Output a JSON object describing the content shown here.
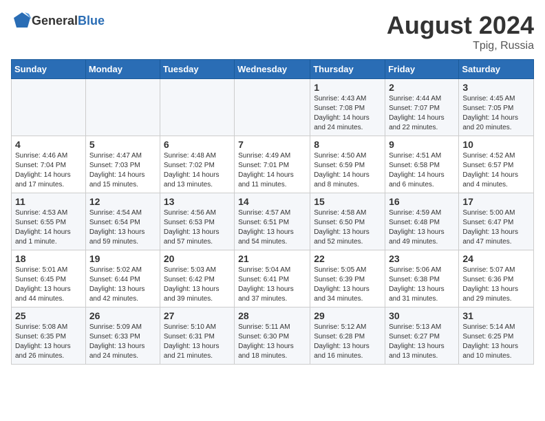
{
  "header": {
    "logo_general": "General",
    "logo_blue": "Blue",
    "title": "August 2024",
    "location": "Tpig, Russia"
  },
  "days_of_week": [
    "Sunday",
    "Monday",
    "Tuesday",
    "Wednesday",
    "Thursday",
    "Friday",
    "Saturday"
  ],
  "weeks": [
    [
      {
        "day": "",
        "info": ""
      },
      {
        "day": "",
        "info": ""
      },
      {
        "day": "",
        "info": ""
      },
      {
        "day": "",
        "info": ""
      },
      {
        "day": "1",
        "info": "Sunrise: 4:43 AM\nSunset: 7:08 PM\nDaylight: 14 hours\nand 24 minutes."
      },
      {
        "day": "2",
        "info": "Sunrise: 4:44 AM\nSunset: 7:07 PM\nDaylight: 14 hours\nand 22 minutes."
      },
      {
        "day": "3",
        "info": "Sunrise: 4:45 AM\nSunset: 7:05 PM\nDaylight: 14 hours\nand 20 minutes."
      }
    ],
    [
      {
        "day": "4",
        "info": "Sunrise: 4:46 AM\nSunset: 7:04 PM\nDaylight: 14 hours\nand 17 minutes."
      },
      {
        "day": "5",
        "info": "Sunrise: 4:47 AM\nSunset: 7:03 PM\nDaylight: 14 hours\nand 15 minutes."
      },
      {
        "day": "6",
        "info": "Sunrise: 4:48 AM\nSunset: 7:02 PM\nDaylight: 14 hours\nand 13 minutes."
      },
      {
        "day": "7",
        "info": "Sunrise: 4:49 AM\nSunset: 7:01 PM\nDaylight: 14 hours\nand 11 minutes."
      },
      {
        "day": "8",
        "info": "Sunrise: 4:50 AM\nSunset: 6:59 PM\nDaylight: 14 hours\nand 8 minutes."
      },
      {
        "day": "9",
        "info": "Sunrise: 4:51 AM\nSunset: 6:58 PM\nDaylight: 14 hours\nand 6 minutes."
      },
      {
        "day": "10",
        "info": "Sunrise: 4:52 AM\nSunset: 6:57 PM\nDaylight: 14 hours\nand 4 minutes."
      }
    ],
    [
      {
        "day": "11",
        "info": "Sunrise: 4:53 AM\nSunset: 6:55 PM\nDaylight: 14 hours\nand 1 minute."
      },
      {
        "day": "12",
        "info": "Sunrise: 4:54 AM\nSunset: 6:54 PM\nDaylight: 13 hours\nand 59 minutes."
      },
      {
        "day": "13",
        "info": "Sunrise: 4:56 AM\nSunset: 6:53 PM\nDaylight: 13 hours\nand 57 minutes."
      },
      {
        "day": "14",
        "info": "Sunrise: 4:57 AM\nSunset: 6:51 PM\nDaylight: 13 hours\nand 54 minutes."
      },
      {
        "day": "15",
        "info": "Sunrise: 4:58 AM\nSunset: 6:50 PM\nDaylight: 13 hours\nand 52 minutes."
      },
      {
        "day": "16",
        "info": "Sunrise: 4:59 AM\nSunset: 6:48 PM\nDaylight: 13 hours\nand 49 minutes."
      },
      {
        "day": "17",
        "info": "Sunrise: 5:00 AM\nSunset: 6:47 PM\nDaylight: 13 hours\nand 47 minutes."
      }
    ],
    [
      {
        "day": "18",
        "info": "Sunrise: 5:01 AM\nSunset: 6:45 PM\nDaylight: 13 hours\nand 44 minutes."
      },
      {
        "day": "19",
        "info": "Sunrise: 5:02 AM\nSunset: 6:44 PM\nDaylight: 13 hours\nand 42 minutes."
      },
      {
        "day": "20",
        "info": "Sunrise: 5:03 AM\nSunset: 6:42 PM\nDaylight: 13 hours\nand 39 minutes."
      },
      {
        "day": "21",
        "info": "Sunrise: 5:04 AM\nSunset: 6:41 PM\nDaylight: 13 hours\nand 37 minutes."
      },
      {
        "day": "22",
        "info": "Sunrise: 5:05 AM\nSunset: 6:39 PM\nDaylight: 13 hours\nand 34 minutes."
      },
      {
        "day": "23",
        "info": "Sunrise: 5:06 AM\nSunset: 6:38 PM\nDaylight: 13 hours\nand 31 minutes."
      },
      {
        "day": "24",
        "info": "Sunrise: 5:07 AM\nSunset: 6:36 PM\nDaylight: 13 hours\nand 29 minutes."
      }
    ],
    [
      {
        "day": "25",
        "info": "Sunrise: 5:08 AM\nSunset: 6:35 PM\nDaylight: 13 hours\nand 26 minutes."
      },
      {
        "day": "26",
        "info": "Sunrise: 5:09 AM\nSunset: 6:33 PM\nDaylight: 13 hours\nand 24 minutes."
      },
      {
        "day": "27",
        "info": "Sunrise: 5:10 AM\nSunset: 6:31 PM\nDaylight: 13 hours\nand 21 minutes."
      },
      {
        "day": "28",
        "info": "Sunrise: 5:11 AM\nSunset: 6:30 PM\nDaylight: 13 hours\nand 18 minutes."
      },
      {
        "day": "29",
        "info": "Sunrise: 5:12 AM\nSunset: 6:28 PM\nDaylight: 13 hours\nand 16 minutes."
      },
      {
        "day": "30",
        "info": "Sunrise: 5:13 AM\nSunset: 6:27 PM\nDaylight: 13 hours\nand 13 minutes."
      },
      {
        "day": "31",
        "info": "Sunrise: 5:14 AM\nSunset: 6:25 PM\nDaylight: 13 hours\nand 10 minutes."
      }
    ]
  ]
}
